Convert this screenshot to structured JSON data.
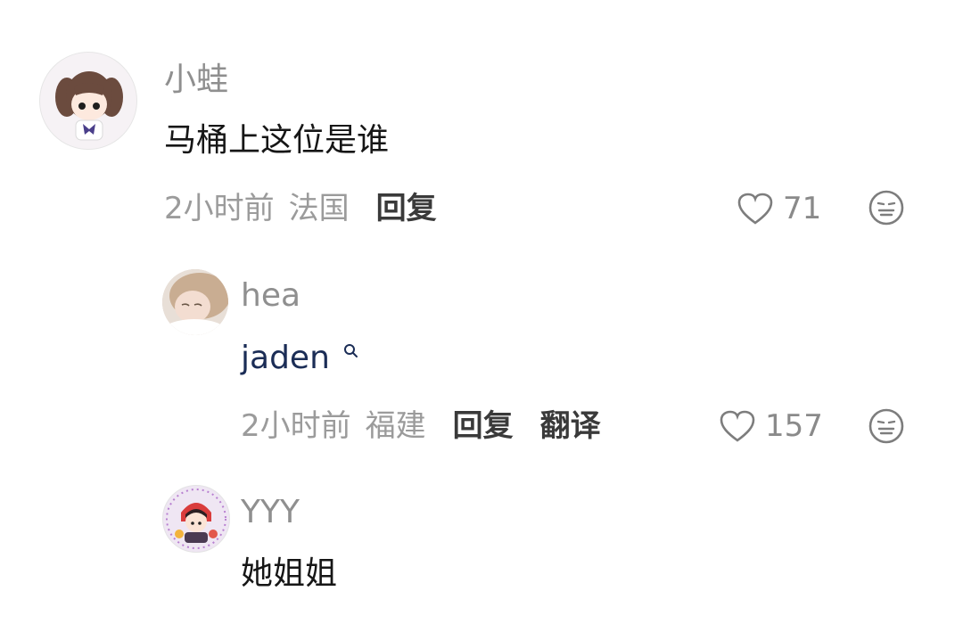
{
  "comments": [
    {
      "username": "小蛙",
      "text": "马桶上这位是谁",
      "time": "2小时前",
      "location": "法国",
      "reply_label": "回复",
      "likes": "71",
      "avatar_icon": "anime-girl-avatar"
    },
    {
      "username": "hea",
      "mention": "jaden",
      "time": "2小时前",
      "location": "福建",
      "reply_label": "回复",
      "translate_label": "翻译",
      "likes": "157",
      "avatar_icon": "photo-avatar"
    },
    {
      "username": "YYY",
      "text": "她姐姐",
      "avatar_icon": "cartoon-avatar"
    }
  ],
  "icons": {
    "like": "heart-outline-icon",
    "dislike": "neutral-face-icon",
    "mention": "search-icon"
  },
  "colors": {
    "username": "#8f8f8f",
    "content": "#161616",
    "meta": "#9b9b9b",
    "mention": "#1b2d56"
  }
}
